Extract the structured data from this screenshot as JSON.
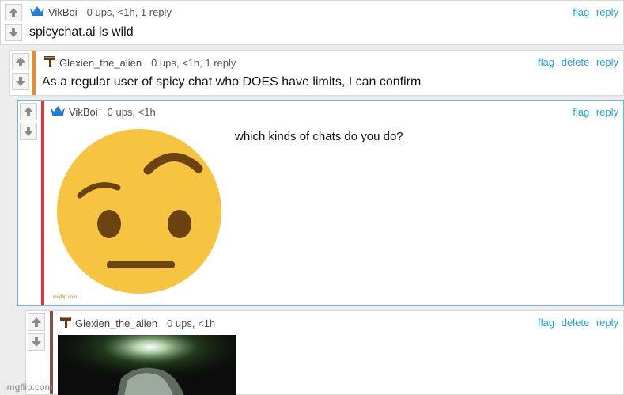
{
  "comments": [
    {
      "username": "VikBoi",
      "meta": "0 ups, <1h, 1 reply",
      "text": "spicychat.ai is wild",
      "actions": [
        "flag",
        "reply"
      ]
    },
    {
      "username": "Glexien_the_alien",
      "meta": "0 ups, <1h, 1 reply",
      "text": "As a regular user of spicy chat who DOES have limits, I can confirm",
      "actions": [
        "flag",
        "delete",
        "reply"
      ],
      "stripe_color": "#f28a1c"
    },
    {
      "username": "VikBoi",
      "meta": "0 ups, <1h",
      "text": "which kinds of chats do you do?",
      "actions": [
        "flag",
        "reply"
      ],
      "stripe_color": "#e0363a",
      "image": "raised-eyebrow-emoji"
    },
    {
      "username": "Glexien_the_alien",
      "meta": "0 ups, <1h",
      "actions": [
        "flag",
        "delete",
        "reply"
      ],
      "stripe_color": "#8b4b4b",
      "image": "dark-glowing-text-image"
    }
  ],
  "icons": {
    "vikboi": "crown-icon",
    "glexien": "hammer-icon",
    "upvote": "upvote-arrow-icon",
    "downvote": "downvote-arrow-icon"
  },
  "colors": {
    "link": "#1ea5d8",
    "crown": "#1e7ed8",
    "emoji": "#f6c440",
    "highlight_border": "#5bc0de"
  },
  "image_caption": "imgflip.com",
  "watermark": "imgflip.com"
}
